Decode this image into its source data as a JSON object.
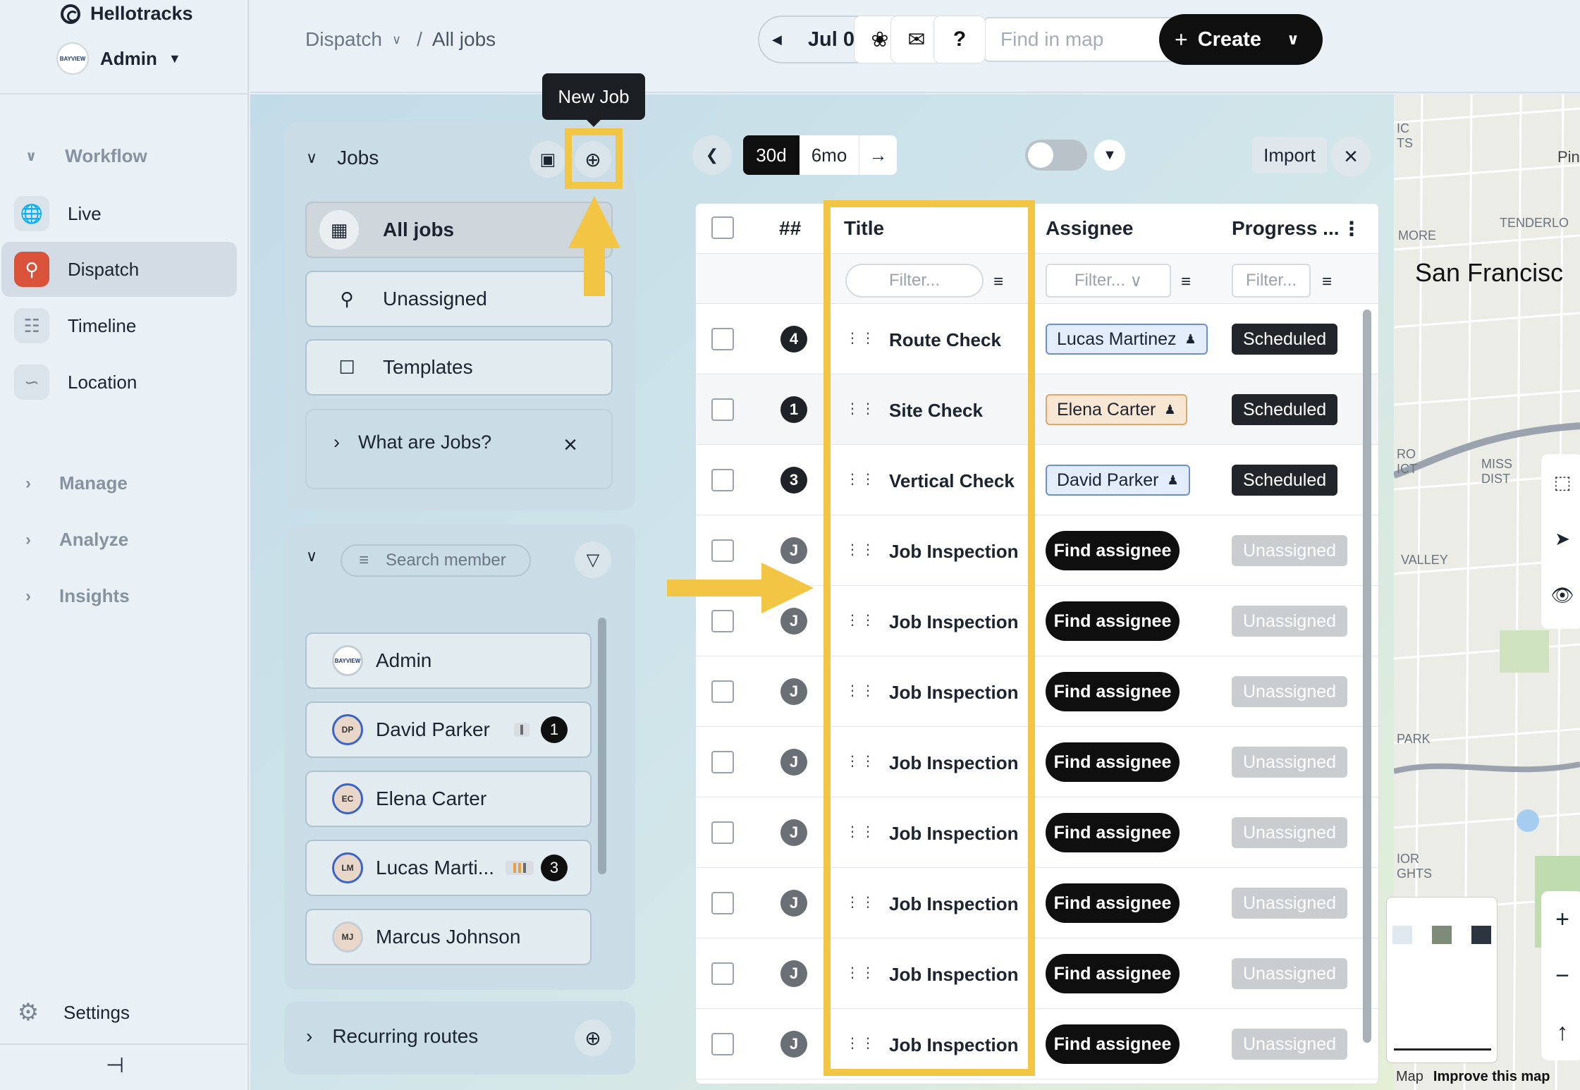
{
  "app": {
    "brand": "Hellotracks",
    "account": "Admin",
    "account_logo_text": "BAYVIEW"
  },
  "sidebar": {
    "groups": {
      "workflow": "Workflow",
      "manage": "Manage",
      "analyze": "Analyze",
      "insights": "Insights"
    },
    "items": [
      {
        "label": "Live",
        "icon": "globe-icon"
      },
      {
        "label": "Dispatch",
        "icon": "dispatch-icon",
        "active": true
      },
      {
        "label": "Timeline",
        "icon": "timeline-icon"
      },
      {
        "label": "Location",
        "icon": "location-icon"
      }
    ],
    "settings": "Settings"
  },
  "topbar": {
    "breadcrumb_parent": "Dispatch",
    "breadcrumb_current": "All jobs",
    "breadcrumb_sep": "/",
    "date": "Jul 04",
    "search_placeholder": "Find in map",
    "help": "?",
    "create": "Create"
  },
  "jobs_panel": {
    "title": "Jobs",
    "tooltip": "New Job",
    "nav": [
      {
        "label": "All jobs",
        "active": true
      },
      {
        "label": "Unassigned"
      },
      {
        "label": "Templates"
      }
    ],
    "info": "What are Jobs?"
  },
  "members_panel": {
    "search_placeholder": "Search member",
    "members": [
      {
        "name": "Admin",
        "initials": "BAYVIEW"
      },
      {
        "name": "David Parker",
        "initials": "DP",
        "count": "1"
      },
      {
        "name": "Elena Carter",
        "initials": "EC"
      },
      {
        "name": "Lucas Marti...",
        "initials": "LM",
        "count": "3"
      },
      {
        "name": "Marcus Johnson",
        "initials": "MJ"
      }
    ]
  },
  "recurring": {
    "title": "Recurring routes"
  },
  "table_toolbar": {
    "range_30d": "30d",
    "range_6mo": "6mo",
    "import": "Import"
  },
  "table": {
    "headers": {
      "num": "##",
      "title": "Title",
      "assignee": "Assignee",
      "progress": "Progress ..."
    },
    "filters": {
      "title": "Filter...",
      "assignee": "Filter...",
      "progress": "Filter..."
    },
    "rows": [
      {
        "num": "4",
        "title": "Route Check",
        "assignee": "Lucas Martinez",
        "status": "Scheduled"
      },
      {
        "num": "1",
        "title": "Site Check",
        "assignee": "Elena Carter",
        "status": "Scheduled"
      },
      {
        "num": "3",
        "title": "Vertical Check",
        "assignee": "David Parker",
        "status": "Scheduled"
      },
      {
        "num": "J",
        "title": "Job Inspection",
        "assignee_button": "Find assignee",
        "status": "Unassigned"
      },
      {
        "num": "J",
        "title": "Job Inspection",
        "assignee_button": "Find assignee",
        "status": "Unassigned"
      },
      {
        "num": "J",
        "title": "Job Inspection",
        "assignee_button": "Find assignee",
        "status": "Unassigned"
      },
      {
        "num": "J",
        "title": "Job Inspection",
        "assignee_button": "Find assignee",
        "status": "Unassigned"
      },
      {
        "num": "J",
        "title": "Job Inspection",
        "assignee_button": "Find assignee",
        "status": "Unassigned"
      },
      {
        "num": "J",
        "title": "Job Inspection",
        "assignee_button": "Find assignee",
        "status": "Unassigned"
      },
      {
        "num": "J",
        "title": "Job Inspection",
        "assignee_button": "Find assignee",
        "status": "Unassigned"
      },
      {
        "num": "J",
        "title": "Job Inspection",
        "assignee_button": "Find assignee",
        "status": "Unassigned"
      }
    ]
  },
  "map": {
    "labels": {
      "tenderloin": "TENDERLO",
      "city": "San Francisc",
      "more": "MORE",
      "pin": "Pin",
      "ts": "IC\nTS",
      "mission": "MISS\nDIST",
      "ro": "RO\nICT",
      "valley": "VALLEY",
      "park": "PARK",
      "ior": "IOR\nGHTS"
    },
    "footer_map": "Map",
    "footer_improve": "Improve this map"
  },
  "colors": {
    "accent": "#f3c544",
    "dispatch": "#d9533b",
    "dark": "#0f0f10"
  }
}
